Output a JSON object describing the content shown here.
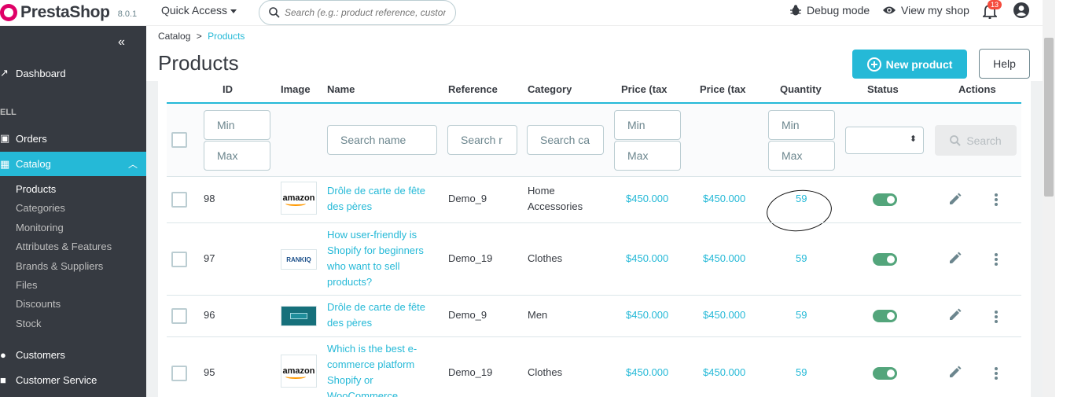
{
  "brand": {
    "name": "PrestaShop",
    "version": "8.0.1"
  },
  "topbar": {
    "quick_access": "Quick Access",
    "search_placeholder": "Search (e.g.: product reference, custon",
    "debug_mode": "Debug mode",
    "view_shop": "View my shop",
    "notif_count": "13"
  },
  "sidebar": {
    "collapse": "«",
    "dashboard": "Dashboard",
    "section_sell": "ELL",
    "orders": "Orders",
    "catalog": "Catalog",
    "catalog_sub": [
      "Products",
      "Categories",
      "Monitoring",
      "Attributes & Features",
      "Brands & Suppliers",
      "Files",
      "Discounts",
      "Stock"
    ],
    "customers": "Customers",
    "customer_service": "Customer Service"
  },
  "breadcrumb": {
    "parent": "Catalog",
    "sep": ">",
    "current": "Products"
  },
  "page_title": "Products",
  "actions": {
    "new_product": "New product",
    "help": "Help"
  },
  "table": {
    "headers": [
      "ID",
      "Image",
      "Name",
      "Reference",
      "Category",
      "Price (tax excl.)",
      "Price (tax incl.)",
      "Quantity",
      "Status",
      "Actions"
    ],
    "filters": {
      "id_min": "Min",
      "id_max": "Max",
      "name": "Search name",
      "reference": "Search r",
      "category": "Search ca",
      "price_min": "Min",
      "price_max": "Max",
      "qty_min": "Min",
      "qty_max": "Max",
      "search_button": "Search"
    },
    "rows": [
      {
        "id": "98",
        "name_l1": "Drôle de carte de fête",
        "name_l2": "des pères",
        "name_l3": "",
        "name_l4": "",
        "image": "amazon",
        "reference": "Demo_9",
        "category_l1": "Home",
        "category_l2": "Accessories",
        "price_excl": "$450.000",
        "price_incl": "$450.000",
        "quantity": "59"
      },
      {
        "id": "97",
        "name_l1": "How user-friendly is",
        "name_l2": "Shopify for beginners",
        "name_l3": "who want to sell",
        "name_l4": "products?",
        "image": "rankiq",
        "reference": "Demo_19",
        "category_l1": "Clothes",
        "category_l2": "",
        "price_excl": "$450.000",
        "price_incl": "$450.000",
        "quantity": "59"
      },
      {
        "id": "96",
        "name_l1": "Drôle de carte de fête",
        "name_l2": "des pères",
        "name_l3": "",
        "name_l4": "",
        "image": "teal-card",
        "reference": "Demo_9",
        "category_l1": "Men",
        "category_l2": "",
        "price_excl": "$450.000",
        "price_incl": "$450.000",
        "quantity": "59"
      },
      {
        "id": "95",
        "name_l1": "Which is the best e-",
        "name_l2": "commerce platform",
        "name_l3": "Shopify or",
        "name_l4": "WooCommerce",
        "image": "amazon",
        "reference": "Demo_19",
        "category_l1": "Clothes",
        "category_l2": "",
        "price_excl": "$450.000",
        "price_incl": "$450.000",
        "quantity": "59"
      }
    ]
  },
  "image_labels": {
    "amazon": "amazon",
    "rankiq": "RANKIQ"
  },
  "colors": {
    "accent": "#25b9d7",
    "sidebar": "#363a41",
    "toggle_on": "#53a57b"
  }
}
